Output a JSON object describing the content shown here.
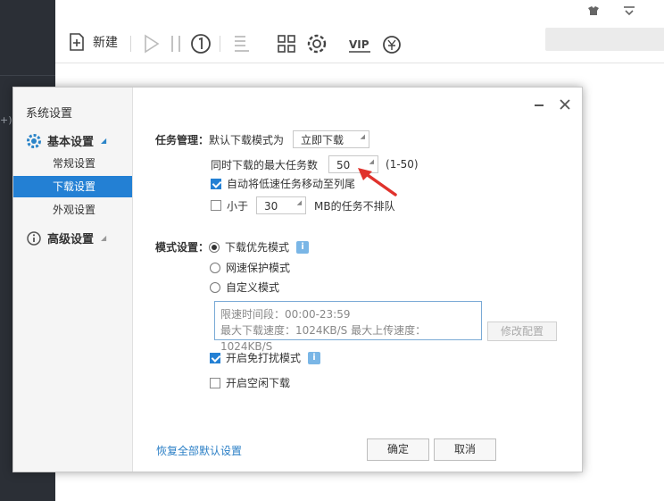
{
  "app": {
    "edge_text": "+)",
    "toolbar": {
      "new_label": "新建",
      "icons": [
        "new-icon",
        "play-icon",
        "pause-icon",
        "speed-icon",
        "list-icon",
        "apps-icon",
        "settings-gear-icon",
        "vip-icon",
        "wallet-icon"
      ]
    },
    "window_controls": [
      "shirt-icon",
      "menu-icon"
    ]
  },
  "dialog": {
    "sidebar": {
      "title": "系统设置",
      "groups": [
        {
          "label": "基本设置",
          "icon": "gear-icon",
          "items": [
            "常规设置",
            "下载设置",
            "外观设置"
          ],
          "active_item": "下载设置"
        },
        {
          "label": "高级设置",
          "icon": "info-icon"
        }
      ]
    },
    "task": {
      "label": "任务管理：",
      "default_mode_label": "默认下载模式为",
      "default_mode_value": "立即下载",
      "max_tasks_label": "同时下载的最大任务数",
      "max_tasks_value": "50",
      "max_tasks_range": "(1-50)",
      "move_slow_label": "自动将低速任务移动至列尾",
      "move_slow_checked": true,
      "less_than_label": "小于",
      "less_than_value": "30",
      "less_than_suffix": "MB的任务不排队",
      "less_than_checked": false
    },
    "mode": {
      "label": "模式设置：",
      "options": [
        "下载优先模式",
        "网速保护模式",
        "自定义模式"
      ],
      "selected": "下载优先模式",
      "limit_period": "限速时间段：00:00-23:59",
      "limit_speeds": "最大下载速度：1024KB/S  最大上传速度：1024KB/S",
      "modify_button": "修改配置",
      "no_disturb_label": "开启免打扰模式",
      "no_disturb_checked": true,
      "idle_download_label": "开启空闲下载",
      "idle_download_checked": false
    },
    "footer": {
      "restore_link": "恢复全部默认设置",
      "ok": "确定",
      "cancel": "取消"
    }
  },
  "colors": {
    "accent": "#2380d4",
    "sidebar_bg": "#f5f5f5",
    "app_dark": "#2b2f36"
  }
}
